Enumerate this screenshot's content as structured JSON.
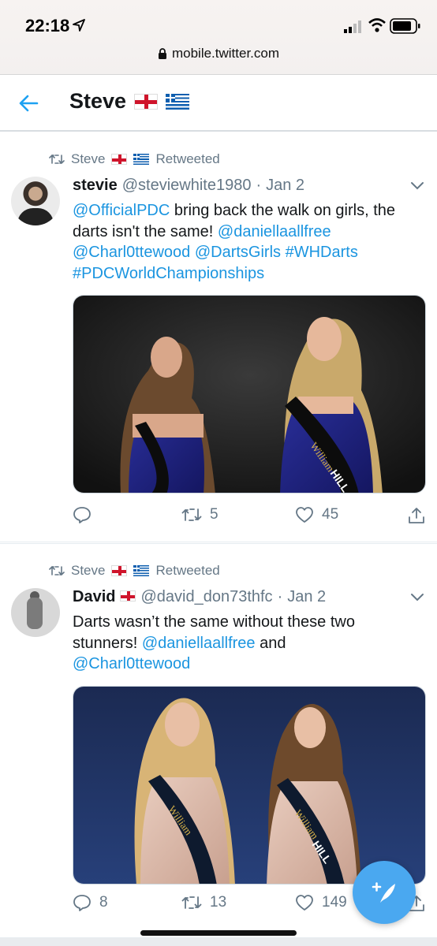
{
  "status_bar": {
    "time": "22:18",
    "url": "mobile.twitter.com"
  },
  "header": {
    "title": "Steve"
  },
  "tweets": [
    {
      "retweeted_by": "Steve",
      "retweeted_label": "Retweeted",
      "name": "stevie",
      "handle": "@steviewhite1980",
      "date": "Jan 2",
      "text": {
        "l1_mention": "@OfficialPDC",
        "l1_text": " bring back the walk on girls, the darts isn't the same! ",
        "l1_mention2": "@daniellaallfree",
        "l2_mention": "@Charl0ttewood",
        "l2_mention2": "@DartsGirls",
        "l2_hashtag": "#WHDarts",
        "l3_hashtag": "#PDCWorldChampionships"
      },
      "replies": "",
      "retweets": "5",
      "likes": "45"
    },
    {
      "retweeted_by": "Steve",
      "retweeted_label": "Retweeted",
      "name": "David",
      "handle": "@david_don73thfc",
      "date": "Jan 2",
      "text": {
        "l1_text": "Darts wasn’t the same without these two stunners! ",
        "l1_mention": "@daniellaallfree",
        "l1_and": " and ",
        "l2_mention": "@Charl0ttewood"
      },
      "replies": "8",
      "retweets": "13",
      "likes": "149"
    }
  ],
  "media_labels": {
    "sash": "William HILL"
  },
  "colors": {
    "link": "#1b95e0",
    "muted": "#657786",
    "fab": "#4aa8f0"
  },
  "icons": [
    "location-arrow-icon",
    "signal-icon",
    "wifi-icon",
    "battery-icon",
    "lock-icon",
    "back-arrow-icon",
    "retweet-icon",
    "chevron-down-icon",
    "reply-icon",
    "like-icon",
    "share-icon",
    "compose-icon"
  ]
}
